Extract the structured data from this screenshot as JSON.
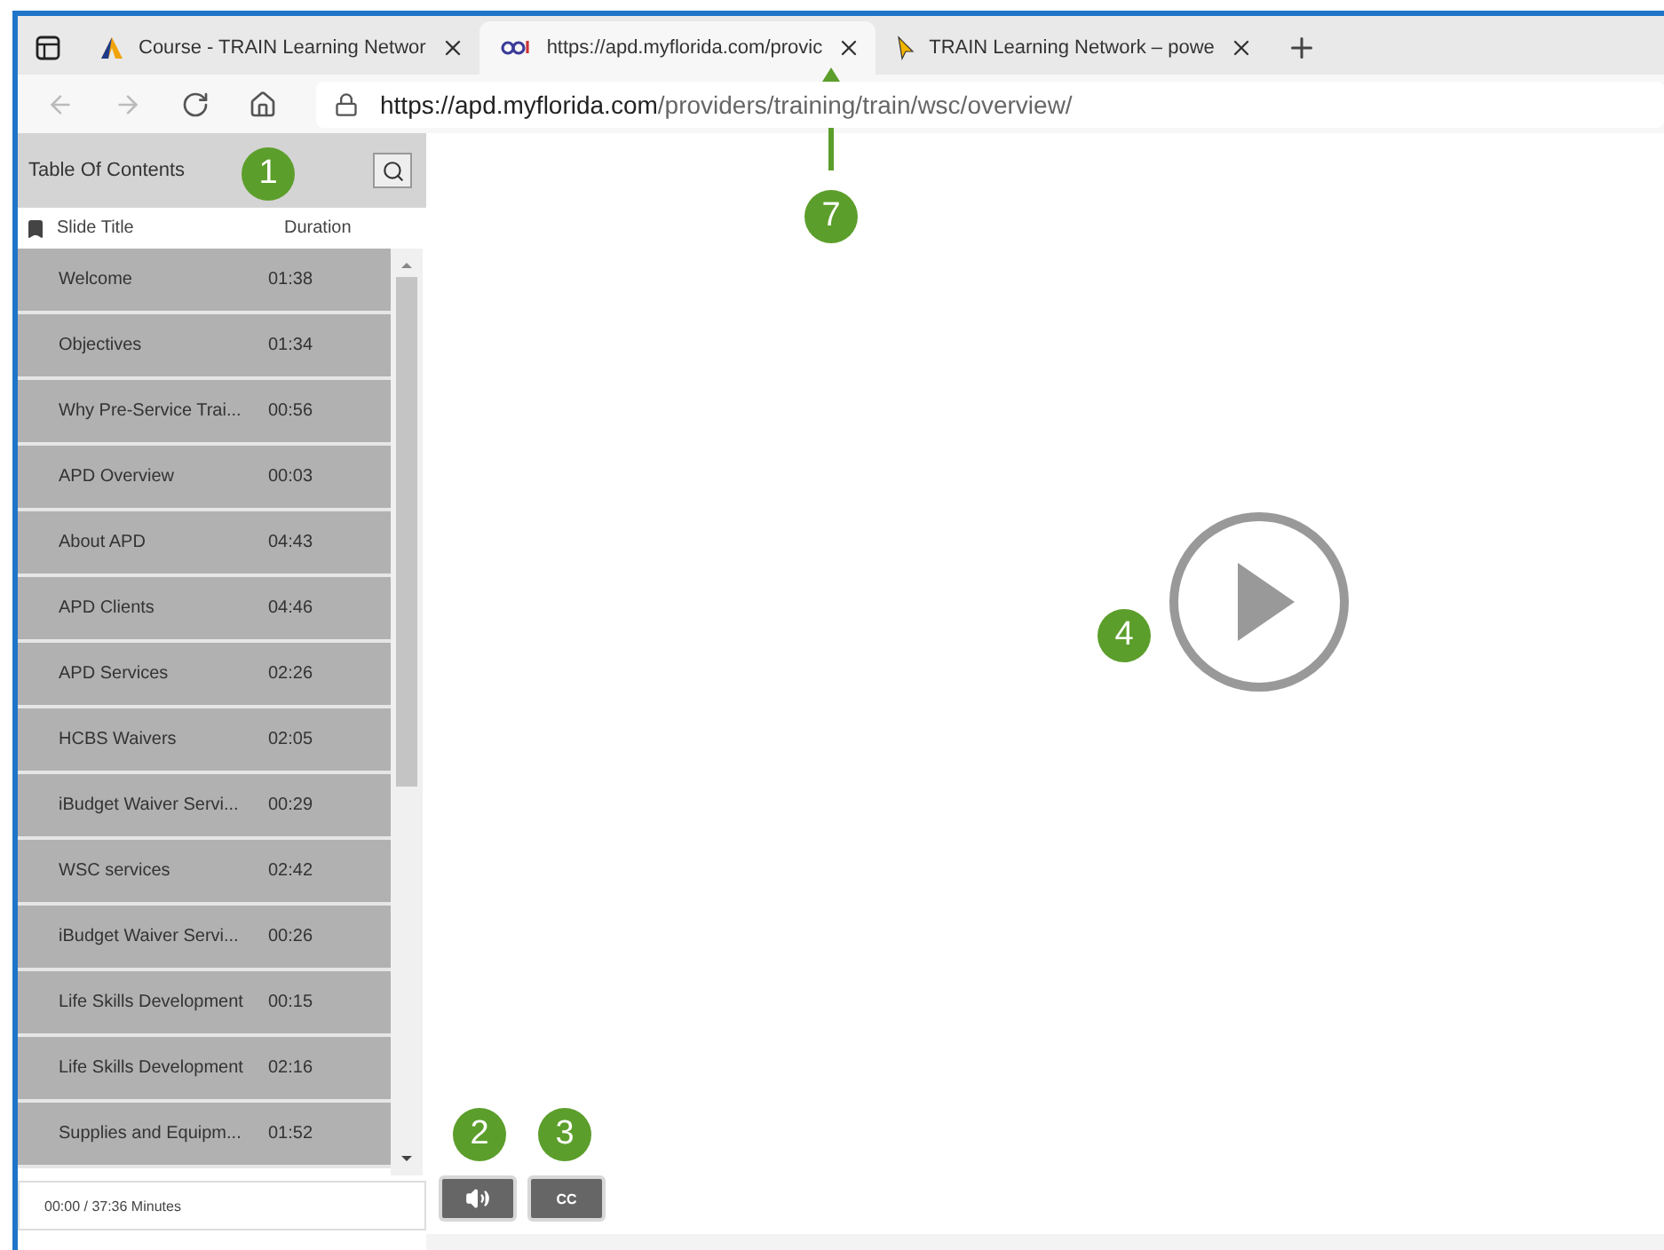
{
  "tabs": [
    {
      "title": "Course - TRAIN Learning Networ",
      "kind": "triangle",
      "selected": false
    },
    {
      "title": "https://apd.myflorida.com/provic",
      "kind": "apd",
      "selected": true
    },
    {
      "title": "TRAIN Learning Network – powe",
      "kind": "cursor",
      "selected": false
    }
  ],
  "address": {
    "host": "https://apd.myflorida.com",
    "path": "/providers/training/train/wsc/overview/"
  },
  "toc": {
    "title": "Table Of Contents",
    "columns": [
      "Slide Title",
      "Duration"
    ],
    "rows": [
      {
        "title": "Welcome",
        "duration": "01:38"
      },
      {
        "title": "Objectives",
        "duration": "01:34"
      },
      {
        "title": "Why Pre-Service Trai...",
        "duration": "00:56"
      },
      {
        "title": "APD Overview",
        "duration": "00:03"
      },
      {
        "title": "About APD",
        "duration": "04:43"
      },
      {
        "title": "APD Clients",
        "duration": "04:46"
      },
      {
        "title": "APD Services",
        "duration": "02:26"
      },
      {
        "title": "HCBS Waivers",
        "duration": "02:05"
      },
      {
        "title": "iBudget Waiver Servi...",
        "duration": "00:29"
      },
      {
        "title": "WSC services",
        "duration": "02:42"
      },
      {
        "title": "iBudget Waiver Servi...",
        "duration": "00:26"
      },
      {
        "title": "Life Skills Development",
        "duration": "00:15"
      },
      {
        "title": "Life Skills Development",
        "duration": "02:16"
      },
      {
        "title": "Supplies and Equipm...",
        "duration": "01:52"
      }
    ],
    "footer": "00:00 / 37:36 Minutes"
  },
  "controls": {
    "cc": "CC"
  },
  "callouts": {
    "toc": "1",
    "audio": "2",
    "cc": "3",
    "play": "4",
    "tab": "7"
  }
}
